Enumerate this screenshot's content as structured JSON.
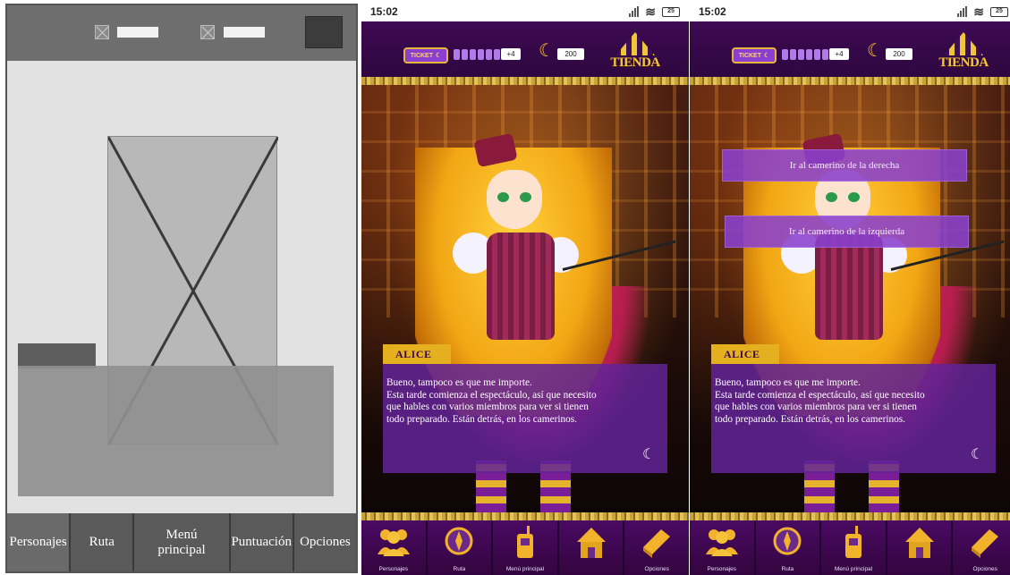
{
  "wireframe": {
    "nav": [
      "Personajes",
      "Ruta",
      "Menú principal",
      "Puntuación",
      "Opciones"
    ]
  },
  "phone": {
    "time": "15:02",
    "battery": "25",
    "ticket_label": "TICKET",
    "ticket_bonus": "+4",
    "moon_count": "200",
    "shop_label": "TIENDA",
    "character_name": "ALICE",
    "dialog_lines": [
      "Bueno, tampoco es que me importe.",
      "Esta tarde comienza el espectáculo, así que necesito",
      "que hables con varios miembros para ver si tienen",
      "todo preparado. Están detrás, en los camerinos."
    ],
    "choices": [
      "Ir al camerino de la derecha",
      "Ir al camerino de la izquierda"
    ],
    "nav": [
      "Personajes",
      "Ruta",
      "Menú principal",
      "",
      "Opciones"
    ],
    "icons": [
      "people-icon",
      "compass-icon",
      "walkie-talkie-icon",
      "circus-icon",
      "book-icon"
    ]
  },
  "colors": {
    "accent_purple": "#3a0b45",
    "gold": "#e5b020",
    "dialog_purple": "#622396"
  }
}
